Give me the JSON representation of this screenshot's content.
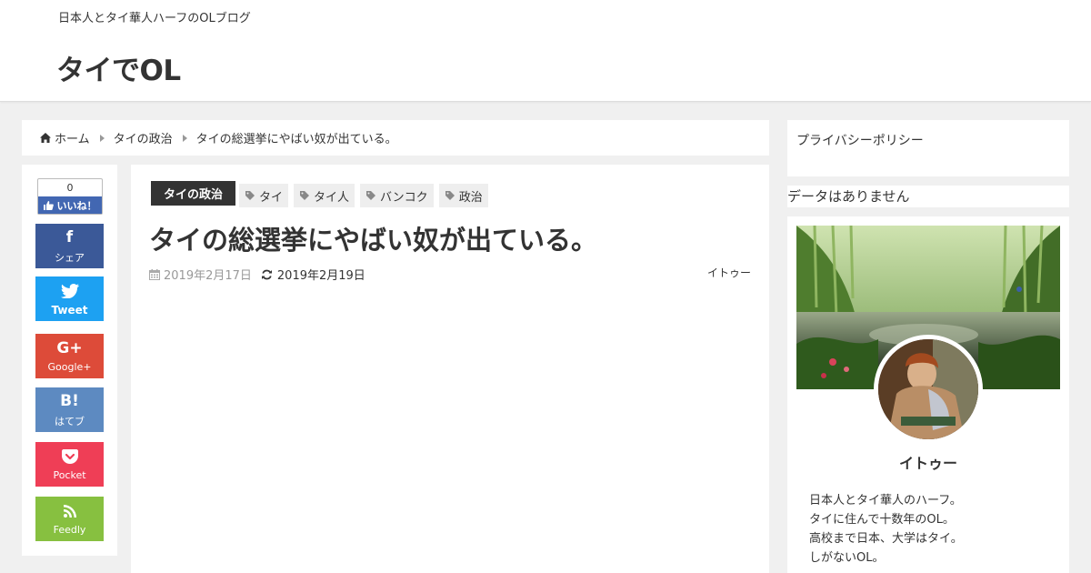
{
  "header": {
    "tagline": "日本人とタイ華人ハーフのOLブログ",
    "site_title": "タイでOL"
  },
  "breadcrumb": {
    "items": [
      "ホーム",
      "タイの政治",
      "タイの総選挙にやばい奴が出ている。"
    ]
  },
  "share": {
    "like_count": "0",
    "like_label": "いいね！",
    "buttons": [
      {
        "icon": "f",
        "label": "シェア"
      },
      {
        "icon": "twitter-bird",
        "label": "Tweet"
      },
      {
        "icon": "G+",
        "label": "Google+"
      },
      {
        "icon": "B!",
        "label": "はてブ"
      },
      {
        "icon": "pocket",
        "label": "Pocket"
      },
      {
        "icon": "rss",
        "label": "Feedly"
      }
    ],
    "colors": {
      "facebook": "#3b5998",
      "twitter": "#1da1f2",
      "googleplus": "#dd4b39",
      "hatena": "#5d8ac1",
      "pocket": "#ef3e56",
      "feedly": "#87c040"
    }
  },
  "article": {
    "category": "タイの政治",
    "tags": [
      "タイ",
      "タイ人",
      "バンコク",
      "政治"
    ],
    "title": "タイの総選挙にやばい奴が出ている。",
    "posted_date": "2019年2月17日",
    "updated_date": "2019年2月19日",
    "author": "イトゥー"
  },
  "sidebar": {
    "privacy_link": "プライバシーポリシー",
    "no_data": "データはありません",
    "profile": {
      "name": "イトゥー",
      "description": [
        "日本人とタイ華人のハーフ。",
        "タイに住んで十数年のOL。",
        "高校まで日本、大学はタイ。",
        "しがないOL。"
      ]
    }
  }
}
